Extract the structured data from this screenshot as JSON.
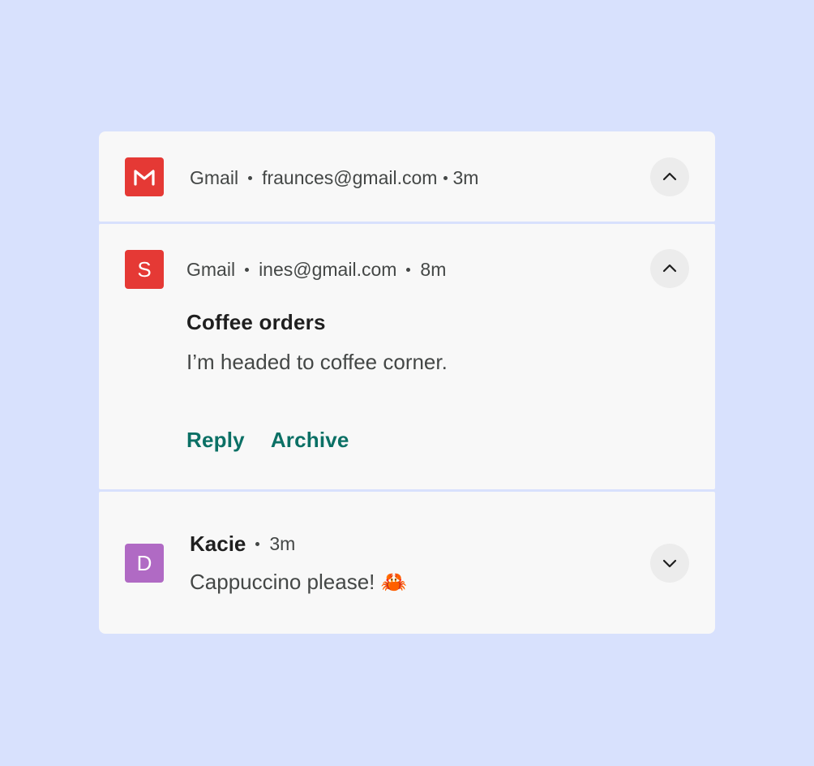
{
  "colors": {
    "background": "#d8e1fd",
    "card": "#f8f8f8",
    "gmail_red": "#e53935",
    "avatar_d": "#b06ac4",
    "action_teal": "#0b7065"
  },
  "notifications": [
    {
      "icon": "gmail-logo-icon",
      "app": "Gmail",
      "account": "fraunces@gmail.com",
      "time": "3m",
      "toggle_icon": "chevron-up-icon"
    },
    {
      "avatar_letter": "S",
      "app": "Gmail",
      "account": "ines@gmail.com",
      "time": "8m",
      "title": "Coffee orders",
      "body": "I’m headed to coffee corner.",
      "actions": [
        "Reply",
        "Archive"
      ],
      "toggle_icon": "chevron-up-icon"
    },
    {
      "avatar_letter": "D",
      "sender": "Kacie",
      "time": "3m",
      "message": "Cappuccino please! 🦀",
      "toggle_icon": "chevron-down-icon"
    }
  ]
}
